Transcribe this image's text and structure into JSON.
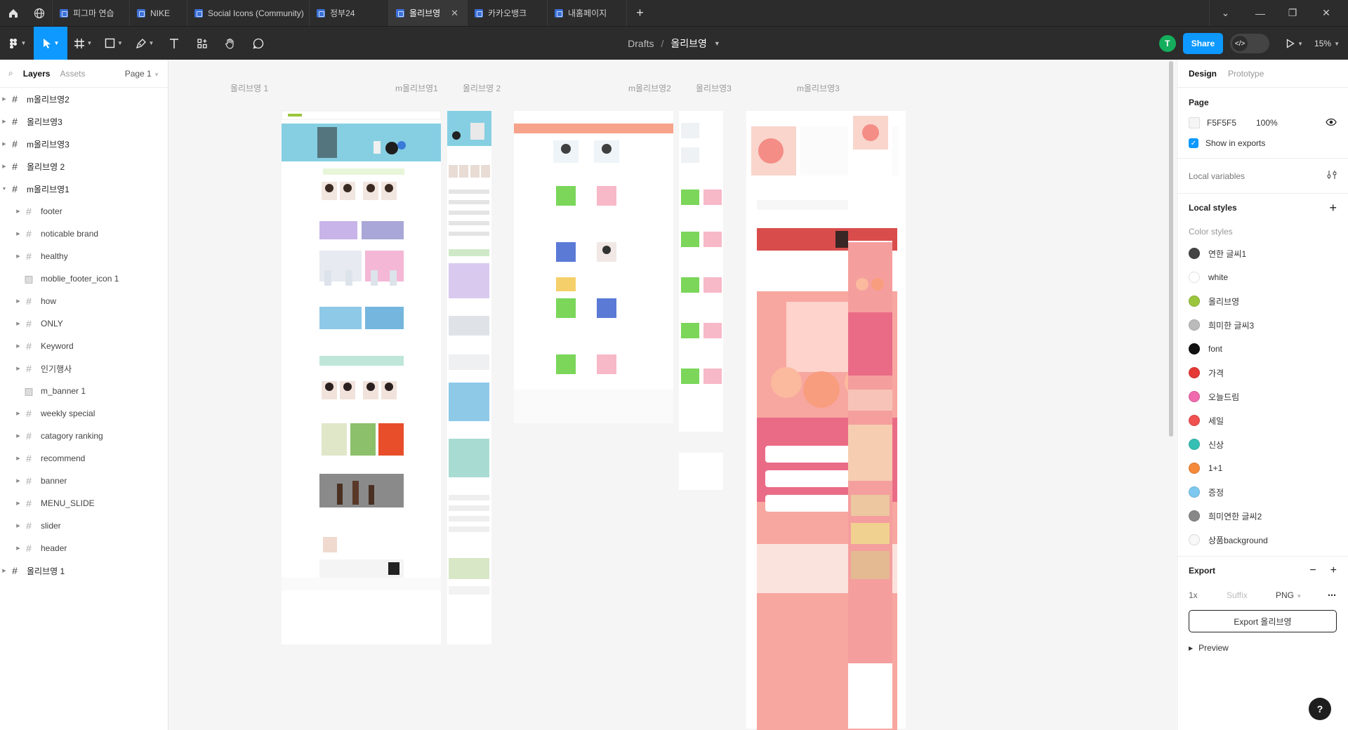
{
  "tabs": [
    {
      "label": "피그마 연습",
      "active": false
    },
    {
      "label": "NIKE",
      "active": false
    },
    {
      "label": "Social Icons (Community)",
      "active": false
    },
    {
      "label": "정부24",
      "active": false
    },
    {
      "label": "올리브영",
      "active": true
    },
    {
      "label": "카카오뱅크",
      "active": false
    },
    {
      "label": "내홈페이지",
      "active": false
    }
  ],
  "breadcrumb": {
    "drafts": "Drafts",
    "separator": "/",
    "file": "올리브영"
  },
  "header_right": {
    "avatar_initial": "T",
    "share_label": "Share",
    "zoom": "15%"
  },
  "left_panel": {
    "tabs": [
      "Layers",
      "Assets"
    ],
    "page_selector": "Page 1",
    "layers": [
      {
        "name": "m올리브영2",
        "level": 0,
        "icon": "frame-icon",
        "expanded": false
      },
      {
        "name": "올리브영3",
        "level": 0,
        "icon": "frame-icon",
        "expanded": false
      },
      {
        "name": "m올리브영3",
        "level": 0,
        "icon": "frame-icon",
        "expanded": false
      },
      {
        "name": "올리브영 2",
        "level": 0,
        "icon": "frame-icon",
        "expanded": false
      },
      {
        "name": "m올리브영1",
        "level": 0,
        "icon": "frame-icon",
        "expanded": true
      },
      {
        "name": "footer",
        "level": 1,
        "icon": "frame-icon"
      },
      {
        "name": "noticable brand",
        "level": 1,
        "icon": "frame-icon"
      },
      {
        "name": "healthy",
        "level": 1,
        "icon": "frame-icon"
      },
      {
        "name": "moblie_footer_icon 1",
        "level": 1,
        "icon": "image-icon"
      },
      {
        "name": "how",
        "level": 1,
        "icon": "frame-icon"
      },
      {
        "name": "ONLY",
        "level": 1,
        "icon": "frame-icon"
      },
      {
        "name": "Keyword",
        "level": 1,
        "icon": "frame-icon"
      },
      {
        "name": "인기행사",
        "level": 1,
        "icon": "frame-icon"
      },
      {
        "name": "m_banner 1",
        "level": 1,
        "icon": "image-icon"
      },
      {
        "name": "weekly special",
        "level": 1,
        "icon": "frame-icon"
      },
      {
        "name": "catagory ranking",
        "level": 1,
        "icon": "frame-icon"
      },
      {
        "name": "recommend",
        "level": 1,
        "icon": "frame-icon"
      },
      {
        "name": "banner",
        "level": 1,
        "icon": "frame-icon"
      },
      {
        "name": "MENU_SLIDE",
        "level": 1,
        "icon": "frame-icon"
      },
      {
        "name": "slider",
        "level": 1,
        "icon": "frame-icon"
      },
      {
        "name": "header",
        "level": 1,
        "icon": "frame-icon"
      },
      {
        "name": "올리브영 1",
        "level": 0,
        "icon": "frame-icon",
        "expanded": false
      }
    ]
  },
  "canvas": {
    "background": "#f5f5f5",
    "frames": [
      "올리브영 1",
      "m올리브영1",
      "올리브영 2",
      "m올리브영2",
      "올리브영3",
      "m올리브영3"
    ]
  },
  "right_panel": {
    "tabs": [
      "Design",
      "Prototype"
    ],
    "page": {
      "title": "Page",
      "color": "F5F5F5",
      "opacity": "100%",
      "show_in_exports": "Show in exports"
    },
    "local_variables": "Local variables",
    "local_styles": "Local styles",
    "color_styles_title": "Color styles",
    "color_styles": [
      {
        "name": "연한 글씨1",
        "color": "#444444"
      },
      {
        "name": "white",
        "color": "#ffffff"
      },
      {
        "name": "올리브영",
        "color": "#9bc53d"
      },
      {
        "name": "희미한 글씨3",
        "color": "#bbbbbb"
      },
      {
        "name": "font",
        "color": "#111111"
      },
      {
        "name": "가격",
        "color": "#e53935"
      },
      {
        "name": "오늘드림",
        "color": "#f06aae"
      },
      {
        "name": "세일",
        "color": "#f05050"
      },
      {
        "name": "신상",
        "color": "#36c0b4"
      },
      {
        "name": "1+1",
        "color": "#f5893a"
      },
      {
        "name": "증정",
        "color": "#7ec8f0"
      },
      {
        "name": "희미연한 글씨2",
        "color": "#888888"
      },
      {
        "name": "상품background",
        "color": "#f8f8f8"
      }
    ],
    "export": {
      "title": "Export",
      "scale": "1x",
      "suffix_placeholder": "Suffix",
      "format": "PNG",
      "button": "Export 올리브영",
      "preview": "Preview"
    }
  },
  "colors": {
    "chrome": "#2c2c2c",
    "accent": "#0d99ff",
    "avatar": "#14ae5c"
  }
}
